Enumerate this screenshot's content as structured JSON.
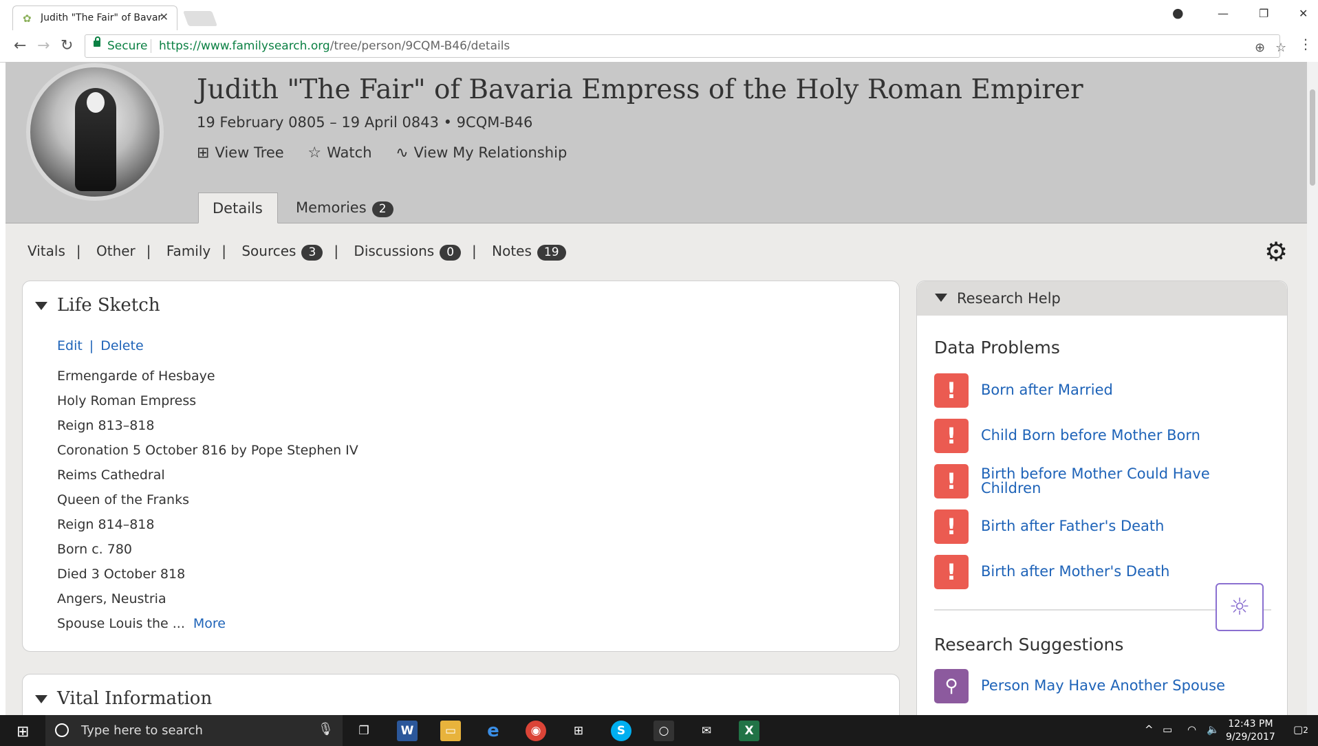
{
  "browser": {
    "tab_title": "Judith \"The Fair\" of Bavar",
    "secure_label": "Secure",
    "url_scheme": "https://",
    "url_host": "www.familysearch.org",
    "url_path": "/tree/person/9CQM-B46/details"
  },
  "person": {
    "name": "Judith \"The Fair\" of Bavaria Empress of the Holy Roman Empirer",
    "lifespan": "19 February 0805 – 19 April 0843 • 9CQM-B46",
    "actions": {
      "view_tree": "View Tree",
      "watch": "Watch",
      "view_relationship": "View My Relationship"
    }
  },
  "tabs": [
    {
      "label": "Details"
    },
    {
      "label": "Memories",
      "count": "2"
    }
  ],
  "subnav": [
    {
      "label": "Vitals"
    },
    {
      "label": "Other"
    },
    {
      "label": "Family"
    },
    {
      "label": "Sources",
      "count": "3"
    },
    {
      "label": "Discussions",
      "count": "0"
    },
    {
      "label": "Notes",
      "count": "19"
    }
  ],
  "life_sketch": {
    "title": "Life Sketch",
    "edit": "Edit",
    "delete": "Delete",
    "lines": [
      "Ermengarde of Hesbaye",
      "Holy Roman Empress",
      "Reign 813–818",
      "Coronation 5 October 816 by Pope Stephen IV",
      "Reims Cathedral",
      "Queen of the Franks",
      "Reign 814–818",
      "Born c. 780",
      "Died 3 October 818",
      "Angers, Neustria",
      "Spouse Louis the ..."
    ],
    "more": "More"
  },
  "vital_information": {
    "title": "Vital Information"
  },
  "research_help": {
    "title": "Research Help",
    "data_problems_title": "Data Problems",
    "data_problems": [
      "Born after Married",
      "Child Born before Mother Born",
      "Birth before Mother Could Have Children",
      "Birth after Father's Death",
      "Birth after Mother's Death"
    ],
    "suggestions_title": "Research Suggestions",
    "suggestions": [
      "Person May Have Another Spouse"
    ]
  },
  "taskbar": {
    "search_placeholder": "Type here to search",
    "time": "12:43 PM",
    "date": "9/29/2017",
    "notifications": "2"
  },
  "colors": {
    "link": "#1e63b8",
    "warning": "#eb5b51",
    "suggestion": "#8c5a9e",
    "header_bg": "#c8c8c8",
    "page_bg": "#ecebe9"
  }
}
